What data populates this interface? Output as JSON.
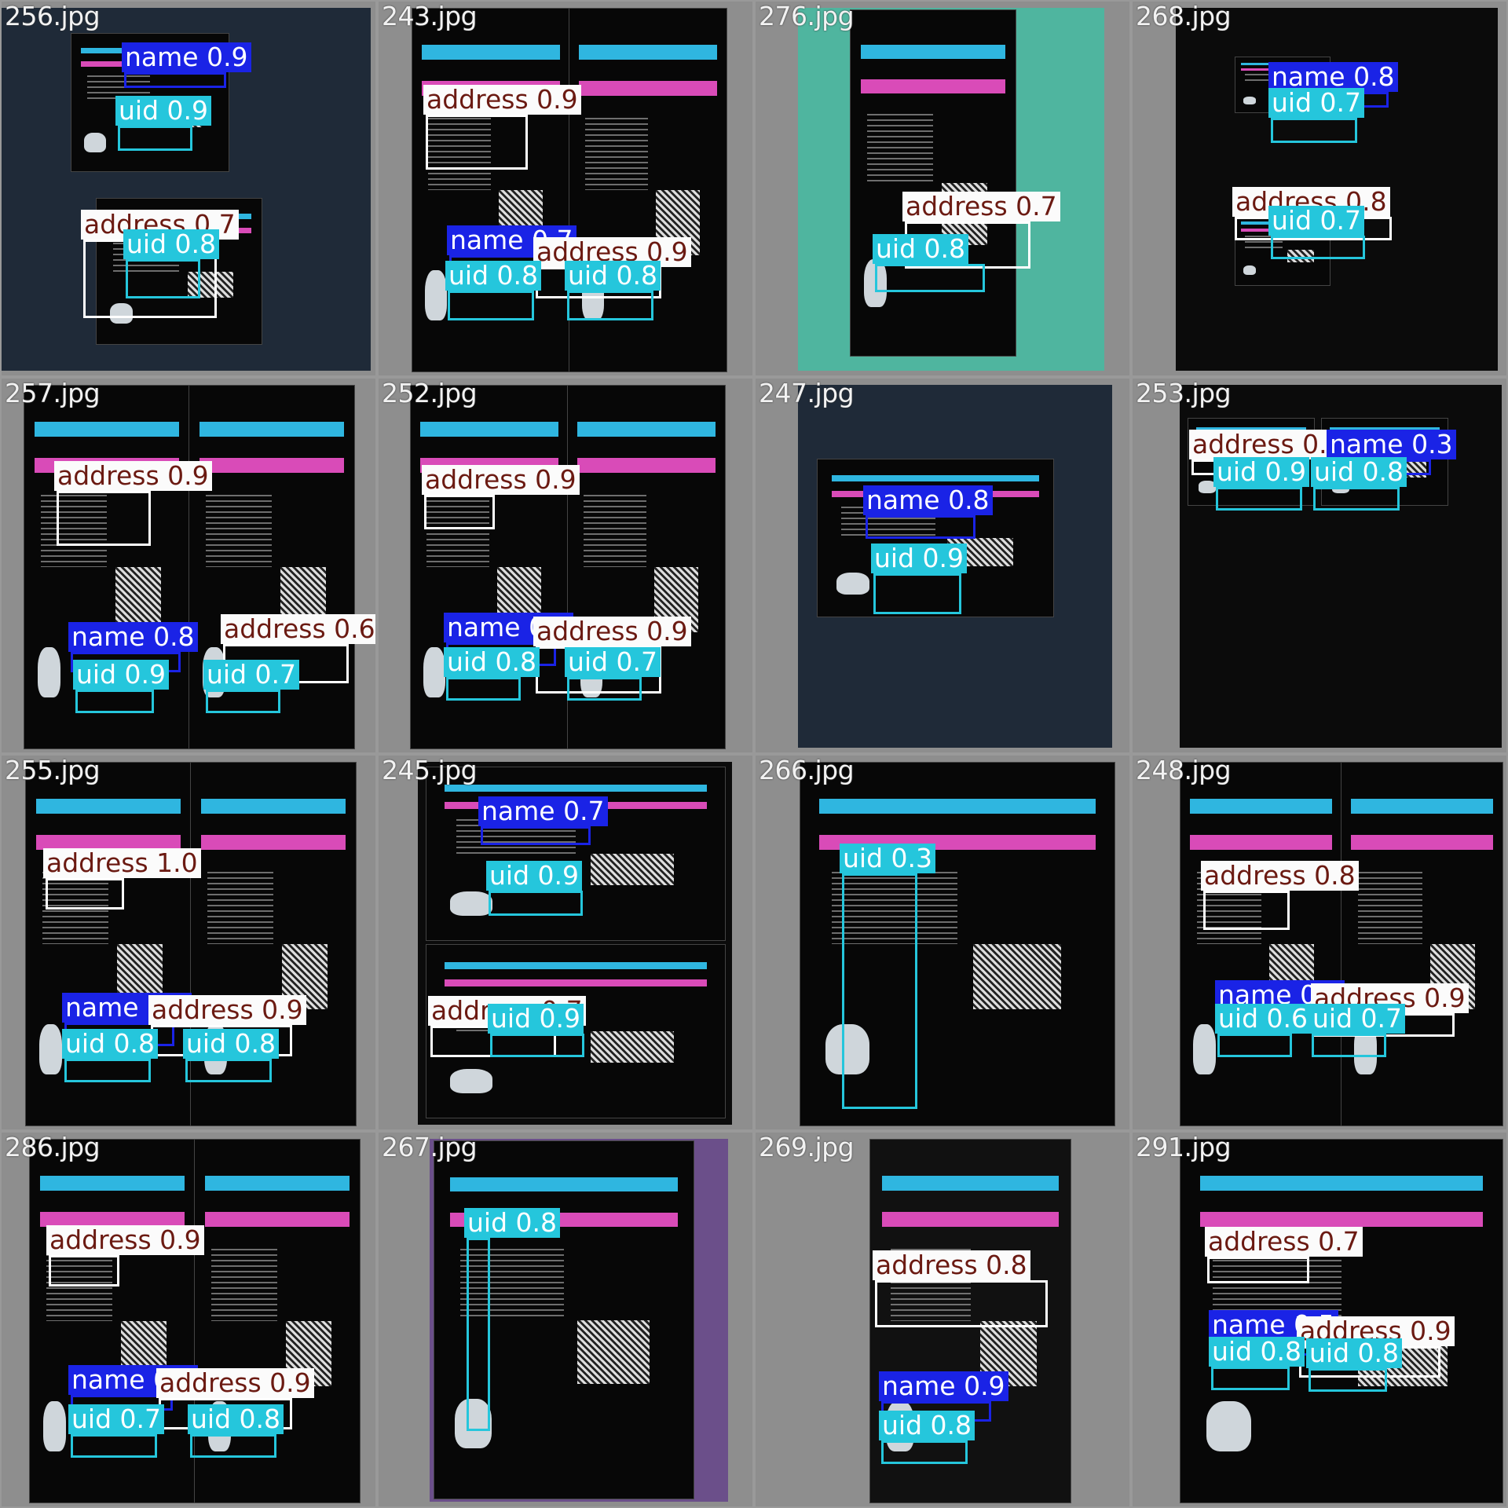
{
  "tiles": [
    {
      "file": "256.jpg",
      "bg": "darkblue",
      "dets": [
        {
          "label": "name",
          "score": "0.9"
        },
        {
          "label": "uid",
          "score": "0.9"
        },
        {
          "label": "address",
          "score": "0.7"
        },
        {
          "label": "uid",
          "score": "0.8"
        }
      ]
    },
    {
      "file": "243.jpg",
      "bg": "dark",
      "dets": [
        {
          "label": "address",
          "score": "0.9"
        },
        {
          "label": "name",
          "score": "0.7"
        },
        {
          "label": "address",
          "score": "0.9"
        },
        {
          "label": "uid",
          "score": "0.8"
        },
        {
          "label": "uid",
          "score": "0.8"
        }
      ]
    },
    {
      "file": "276.jpg",
      "bg": "teal",
      "dets": [
        {
          "label": "address",
          "score": "0.7"
        },
        {
          "label": "uid",
          "score": "0.8"
        }
      ]
    },
    {
      "file": "268.jpg",
      "bg": "dark",
      "dets": [
        {
          "label": "name",
          "score": "0.8"
        },
        {
          "label": "uid",
          "score": "0.7"
        },
        {
          "label": "address",
          "score": "0.8"
        },
        {
          "label": "uid",
          "score": "0.7"
        }
      ]
    },
    {
      "file": "257.jpg",
      "bg": "dark",
      "dets": [
        {
          "label": "address",
          "score": "0.9"
        },
        {
          "label": "name",
          "score": "0.8"
        },
        {
          "label": "address",
          "score": "0.6"
        },
        {
          "label": "uid",
          "score": "0.9"
        },
        {
          "label": "uid",
          "score": "0.7"
        }
      ]
    },
    {
      "file": "252.jpg",
      "bg": "dark",
      "dets": [
        {
          "label": "address",
          "score": "0.9"
        },
        {
          "label": "name",
          "score": "0.7"
        },
        {
          "label": "address",
          "score": "0.9"
        },
        {
          "label": "uid",
          "score": "0.8"
        },
        {
          "label": "uid",
          "score": "0.7"
        }
      ]
    },
    {
      "file": "247.jpg",
      "bg": "darkblue",
      "dets": [
        {
          "label": "name",
          "score": "0.8"
        },
        {
          "label": "uid",
          "score": "0.9"
        }
      ]
    },
    {
      "file": "253.jpg",
      "bg": "dark",
      "dets": [
        {
          "label": "address",
          "score": "0.3"
        },
        {
          "label": "name",
          "score": "0.3"
        },
        {
          "label": "uid",
          "score": "0.9"
        },
        {
          "label": "uid",
          "score": "0.8"
        }
      ]
    },
    {
      "file": "255.jpg",
      "bg": "dark",
      "dets": [
        {
          "label": "address",
          "score": "1.0"
        },
        {
          "label": "name",
          "score": "0.4"
        },
        {
          "label": "address",
          "score": "0.9"
        },
        {
          "label": "uid",
          "score": "0.8"
        },
        {
          "label": "uid",
          "score": "0.8"
        }
      ]
    },
    {
      "file": "245.jpg",
      "bg": "dark",
      "dets": [
        {
          "label": "name",
          "score": "0.7"
        },
        {
          "label": "uid",
          "score": "0.9"
        },
        {
          "label": "address",
          "score": "0.7"
        },
        {
          "label": "uid",
          "score": "0.9"
        }
      ]
    },
    {
      "file": "266.jpg",
      "bg": "dark",
      "dets": [
        {
          "label": "uid",
          "score": "0.3"
        }
      ]
    },
    {
      "file": "248.jpg",
      "bg": "dark",
      "dets": [
        {
          "label": "address",
          "score": "0.8"
        },
        {
          "label": "name",
          "score": "0.3"
        },
        {
          "label": "address",
          "score": "0.9"
        },
        {
          "label": "uid",
          "score": "0.6"
        },
        {
          "label": "uid",
          "score": "0.7"
        }
      ]
    },
    {
      "file": "286.jpg",
      "bg": "dark",
      "dets": [
        {
          "label": "address",
          "score": "0.9"
        },
        {
          "label": "name",
          "score": "0.7"
        },
        {
          "label": "address",
          "score": "0.9"
        },
        {
          "label": "uid",
          "score": "0.7"
        },
        {
          "label": "uid",
          "score": "0.8"
        }
      ]
    },
    {
      "file": "267.jpg",
      "bg": "purple",
      "dets": [
        {
          "label": "uid",
          "score": "0.8"
        }
      ]
    },
    {
      "file": "269.jpg",
      "bg": "white",
      "dets": [
        {
          "label": "address",
          "score": "0.8"
        },
        {
          "label": "name",
          "score": "0.9"
        },
        {
          "label": "uid",
          "score": "0.8"
        }
      ]
    },
    {
      "file": "291.jpg",
      "bg": "dark",
      "dets": [
        {
          "label": "address",
          "score": "0.7"
        },
        {
          "label": "name",
          "score": "0.5"
        },
        {
          "label": "address",
          "score": "0.9"
        },
        {
          "label": "uid",
          "score": "0.8"
        },
        {
          "label": "uid",
          "score": "0.8"
        }
      ]
    }
  ],
  "colors": {
    "name": "#1a23e6",
    "uid": "#25c6dc",
    "address": "#fbfbfb",
    "address_text": "#6b1a12",
    "grid_bg": "#8e8e8e"
  }
}
